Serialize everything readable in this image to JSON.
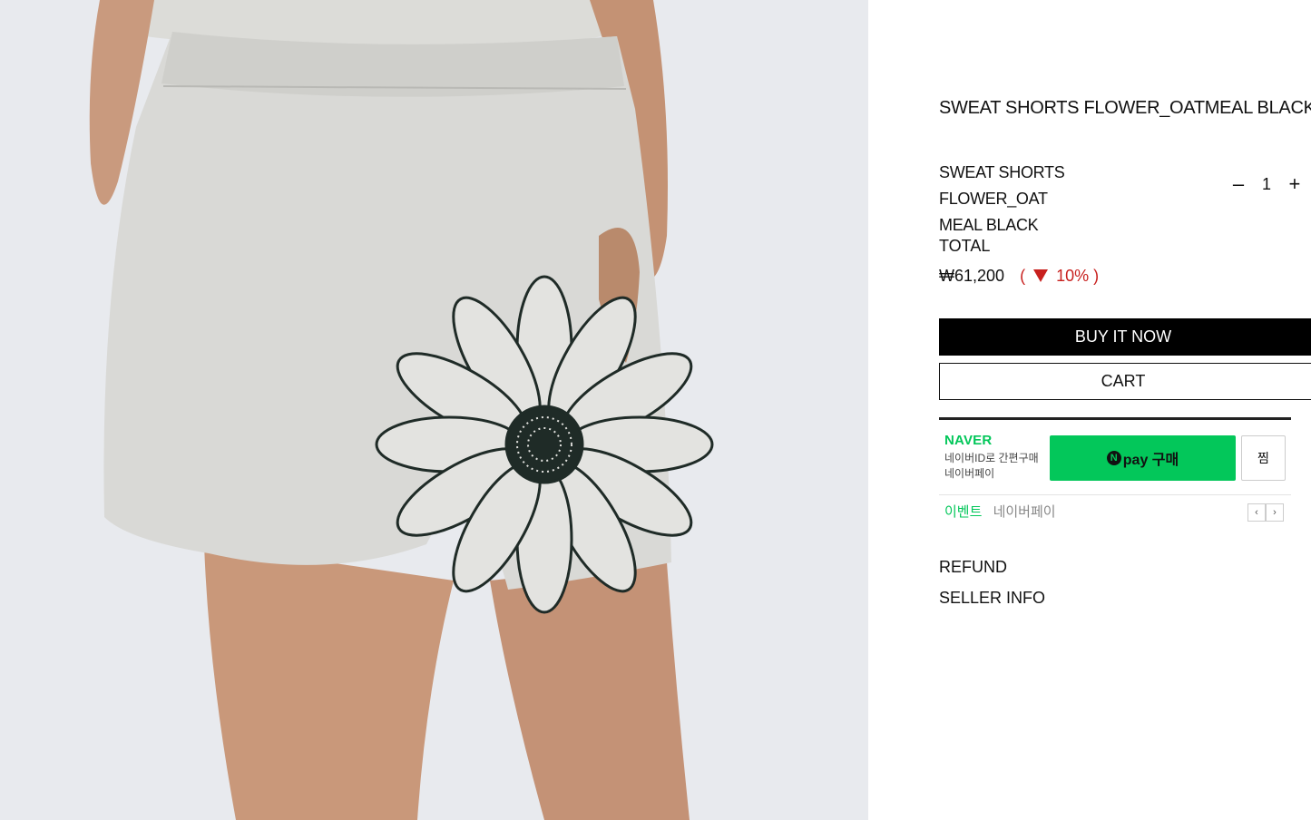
{
  "product": {
    "title": "SWEAT SHORTS FLOWER_OATMEAL BLACK",
    "image_alt": "Model wearing oatmeal sweat shorts with black flower print"
  },
  "option": {
    "name_line1": "SWEAT SHORTS FLOWER_OAT",
    "name_line2": "MEAL BLACK",
    "minus": "–",
    "quantity": "1",
    "plus": "+"
  },
  "total": {
    "label": "TOTAL",
    "price": "₩61,200",
    "discount_open": "(",
    "discount_value": "10%",
    "discount_close": ")"
  },
  "buttons": {
    "buy_now": "BUY IT NOW",
    "cart": "CART"
  },
  "naver": {
    "logo": "NAVER",
    "sub_line1": "네이버ID로 간편구매",
    "sub_line2": "네이버페이",
    "pay_n": "N",
    "pay_label": "pay 구매",
    "zzim": "찜",
    "event_label": "이벤트",
    "event_text": "네이버페이",
    "prev": "‹",
    "next": "›"
  },
  "links": {
    "refund": "REFUND",
    "seller_info": "SELLER INFO"
  },
  "colors": {
    "accent_discount": "#c8201e",
    "naver_green": "#03c75a",
    "buy_bg": "#000000"
  }
}
